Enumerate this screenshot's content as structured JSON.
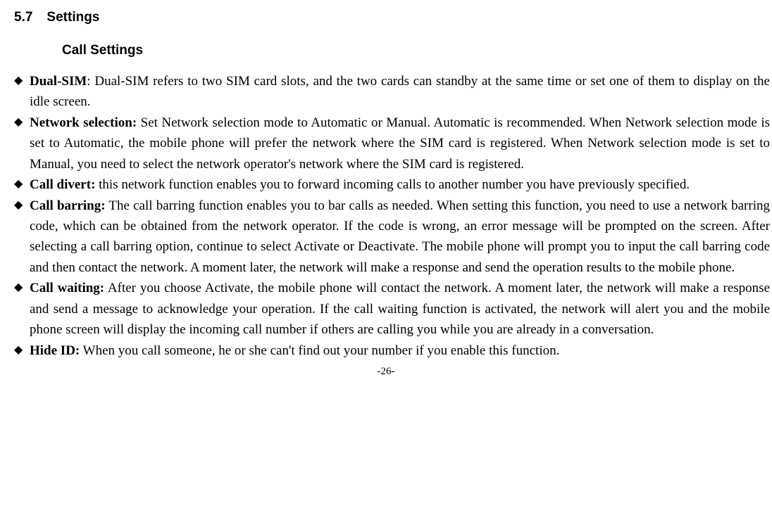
{
  "section": {
    "number": "5.7",
    "title": "Settings"
  },
  "subsection_title": "Call Settings",
  "items": [
    {
      "title": "Dual-SIM",
      "separator": ": ",
      "body": "Dual-SIM refers to two SIM card slots, and the two cards can standby at the same time or set one of them to display on the idle screen."
    },
    {
      "title": "Network selection:",
      "separator": " ",
      "body": "Set Network selection mode to Automatic or Manual. Automatic is recommended. When Network selection mode is set to Automatic, the mobile phone will prefer the network where the SIM card is registered. When Network selection mode is set to Manual, you need to select the network operator's network where the SIM card is registered."
    },
    {
      "title": "Call divert:",
      "separator": " ",
      "body": "this network function enables you to forward incoming calls to another number you have previously specified."
    },
    {
      "title": "Call barring:",
      "separator": " ",
      "body": "The call barring function enables you to bar calls as needed. When setting this function, you need to use a network barring code, which can be obtained from the network operator. If the code is wrong, an error message will be prompted on the screen. After selecting a call barring option, continue to select Activate or Deactivate. The mobile phone will prompt you to input the call barring code and then contact the network. A moment later, the network will make a response and send the operation results to the mobile phone."
    },
    {
      "title": "Call waiting:",
      "separator": " ",
      "body": "After you choose Activate, the mobile phone will contact the network. A moment later, the network will make a response and send a message to acknowledge your operation. If the call waiting function is activated, the network will alert you and the mobile phone screen will display the incoming call number if others are calling you while you are already in a conversation."
    },
    {
      "title": "Hide ID:",
      "separator": " ",
      "body": "When you call someone, he or she can't find out your number if you enable this function."
    }
  ],
  "page_number": "-26-"
}
